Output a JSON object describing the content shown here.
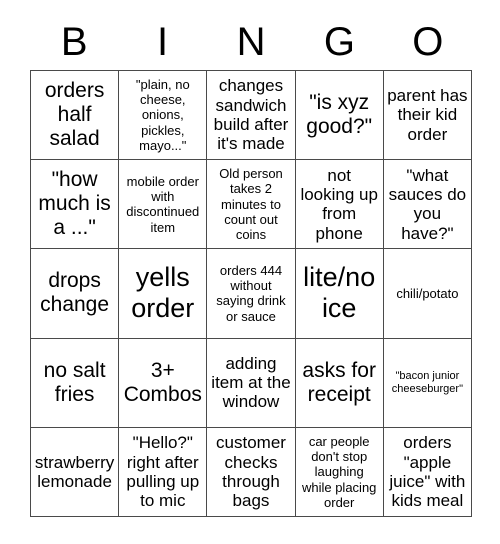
{
  "card": {
    "title_letters": [
      "B",
      "I",
      "N",
      "G",
      "O"
    ],
    "grid_size": "5x5",
    "colors": {
      "background": "#ffffff",
      "text": "#000000",
      "border": "#4a4a4a"
    }
  },
  "cells": [
    {
      "id": "b1",
      "column": "B",
      "row": 1,
      "text": "orders half salad",
      "size": "lg"
    },
    {
      "id": "i1",
      "column": "I",
      "row": 1,
      "text": "\"plain, no cheese, onions, pickles, mayo...\"",
      "size": "sm"
    },
    {
      "id": "n1",
      "column": "N",
      "row": 1,
      "text": "changes sandwich build after it's made",
      "size": "md"
    },
    {
      "id": "g1",
      "column": "G",
      "row": 1,
      "text": "\"is xyz good?\"",
      "size": "lg"
    },
    {
      "id": "o1",
      "column": "O",
      "row": 1,
      "text": "parent has their kid order",
      "size": "md"
    },
    {
      "id": "b2",
      "column": "B",
      "row": 2,
      "text": "\"how much is a ...\"",
      "size": "lg"
    },
    {
      "id": "i2",
      "column": "I",
      "row": 2,
      "text": "mobile order with discontinued item",
      "size": "sm"
    },
    {
      "id": "n2",
      "column": "N",
      "row": 2,
      "text": "Old person takes 2 minutes to count out coins",
      "size": "sm"
    },
    {
      "id": "g2",
      "column": "G",
      "row": 2,
      "text": "not looking up from phone",
      "size": "md"
    },
    {
      "id": "o2",
      "column": "O",
      "row": 2,
      "text": "\"what sauces do you have?\"",
      "size": "md"
    },
    {
      "id": "b3",
      "column": "B",
      "row": 3,
      "text": "drops change",
      "size": "lg"
    },
    {
      "id": "i3",
      "column": "I",
      "row": 3,
      "text": "yells order",
      "size": "xl"
    },
    {
      "id": "n3",
      "column": "N",
      "row": 3,
      "text": "orders 444 without saying drink or sauce",
      "size": "sm"
    },
    {
      "id": "g3",
      "column": "G",
      "row": 3,
      "text": "lite/no ice",
      "size": "xl"
    },
    {
      "id": "o3",
      "column": "O",
      "row": 3,
      "text": "chili/potato",
      "size": "sm"
    },
    {
      "id": "b4",
      "column": "B",
      "row": 4,
      "text": "no salt fries",
      "size": "lg"
    },
    {
      "id": "i4",
      "column": "I",
      "row": 4,
      "text": "3+ Combos",
      "size": "lg"
    },
    {
      "id": "n4",
      "column": "N",
      "row": 4,
      "text": "adding item at the window",
      "size": "md"
    },
    {
      "id": "g4",
      "column": "G",
      "row": 4,
      "text": "asks for receipt",
      "size": "lg"
    },
    {
      "id": "o4",
      "column": "O",
      "row": 4,
      "text": "\"bacon junior cheeseburger\"",
      "size": "xs"
    },
    {
      "id": "b5",
      "column": "B",
      "row": 5,
      "text": "strawberry lemonade",
      "size": "md"
    },
    {
      "id": "i5",
      "column": "I",
      "row": 5,
      "text": "\"Hello?\" right after pulling up to mic",
      "size": "md"
    },
    {
      "id": "n5",
      "column": "N",
      "row": 5,
      "text": "customer checks through bags",
      "size": "md"
    },
    {
      "id": "g5",
      "column": "G",
      "row": 5,
      "text": "car people don't stop laughing while placing order",
      "size": "sm"
    },
    {
      "id": "o5",
      "column": "O",
      "row": 5,
      "text": "orders \"apple juice\" with kids meal",
      "size": "md"
    }
  ]
}
